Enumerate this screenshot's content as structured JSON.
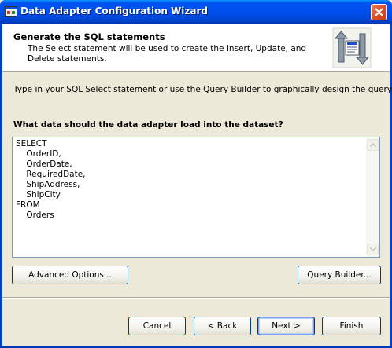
{
  "window": {
    "title": "Data Adapter Configuration Wizard"
  },
  "header": {
    "title": "Generate the SQL statements",
    "description": "The Select statement will be used to create the Insert, Update, and Delete statements.",
    "icon": "data-adapter-arrows-icon"
  },
  "body": {
    "instruction": "Type in your SQL Select statement or use the Query Builder to graphically design the query.",
    "question": "What data should the data adapter load into the dataset?",
    "sql_text": "SELECT\n    OrderID,\n    OrderDate,\n    RequiredDate,\n    ShipAddress,\n    ShipCity\nFROM\n    Orders"
  },
  "buttons": {
    "advanced_options": "Advanced Options...",
    "query_builder": "Query Builder...",
    "cancel": "Cancel",
    "back": "< Back",
    "next": "Next >",
    "finish": "Finish"
  },
  "colors": {
    "titlebar": "#0050EE",
    "dialog_bg": "#ECE9D8",
    "close_button": "#D8522A"
  }
}
